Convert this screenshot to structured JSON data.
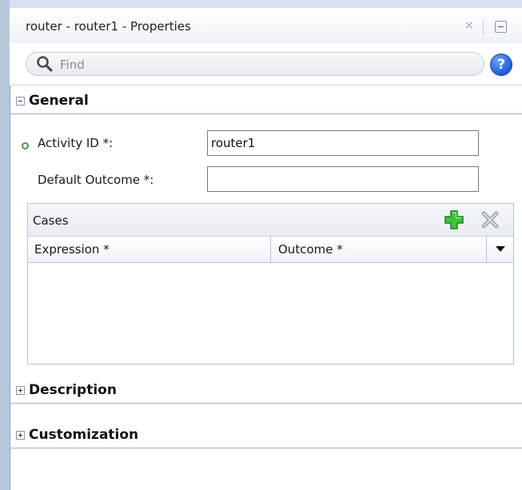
{
  "window": {
    "title": "router - router1 - Properties",
    "close_glyph": "×"
  },
  "search": {
    "placeholder": "Find",
    "value": ""
  },
  "help": {
    "glyph": "?"
  },
  "sections": {
    "general": {
      "title": "General",
      "expanded": true
    },
    "description": {
      "title": "Description",
      "expanded": false
    },
    "customization": {
      "title": "Customization",
      "expanded": false
    }
  },
  "form": {
    "activity_id": {
      "label": "Activity ID *:",
      "value": "router1"
    },
    "default_outcome": {
      "label": "Default Outcome *:",
      "value": ""
    }
  },
  "cases": {
    "title": "Cases",
    "columns": [
      "Expression *",
      "Outcome *"
    ],
    "rows": []
  },
  "icons": {
    "search": "magnifier-icon",
    "help": "help-icon",
    "add": "add-plus-icon",
    "delete": "delete-x-icon",
    "required_dot": "required-indicator-icon"
  },
  "colors": {
    "accent_blue": "#1d5bd6",
    "add_green": "#2ea82e",
    "section_rule": "#9fb0c4",
    "required_green": "#3aa04a"
  }
}
